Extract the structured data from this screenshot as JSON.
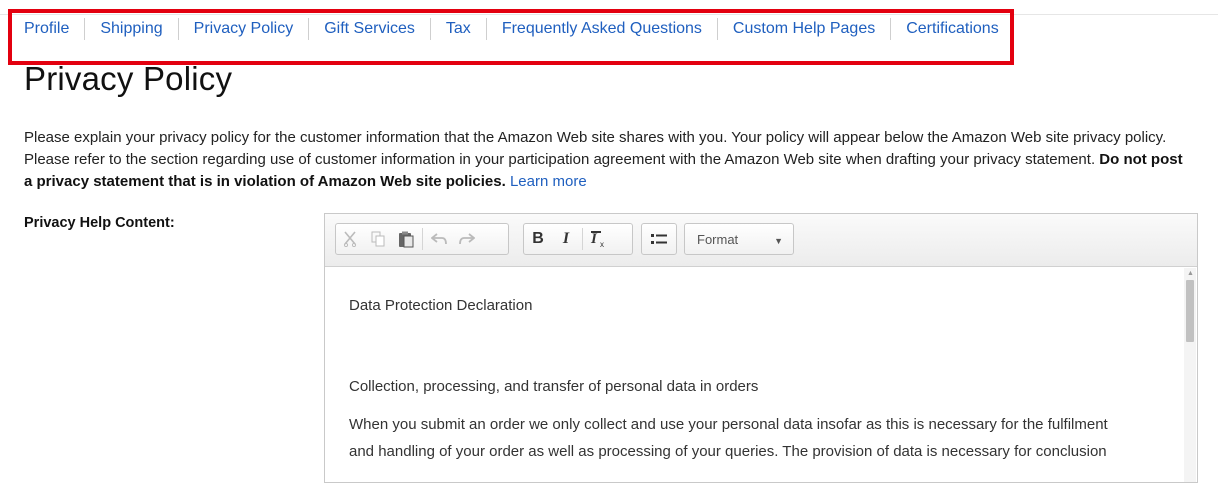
{
  "nav": {
    "tabs": [
      {
        "label": "Profile"
      },
      {
        "label": "Shipping"
      },
      {
        "label": "Privacy Policy"
      },
      {
        "label": "Gift Services"
      },
      {
        "label": "Tax"
      },
      {
        "label": "Frequently Asked Questions"
      },
      {
        "label": "Custom Help Pages"
      },
      {
        "label": "Certifications"
      }
    ],
    "highlight_color": "#e3000f",
    "link_color": "#1f5fbf"
  },
  "page": {
    "title": "Privacy Policy",
    "description": "Please explain your privacy policy for the customer information that the Amazon Web site shares with you. Your policy will appear below the Amazon Web site privacy policy. Please refer to the section regarding use of customer information in your participation agreement with the Amazon Web site when drafting your privacy statement.",
    "warning": "Do not post a privacy statement that is in violation of Amazon Web site policies.",
    "learn_more": "Learn more"
  },
  "form": {
    "field_label": "Privacy Help Content:"
  },
  "editor": {
    "toolbar": {
      "icons": [
        "cut-icon",
        "copy-icon",
        "paste-icon",
        "undo-icon",
        "redo-icon",
        "bold-icon",
        "italic-icon",
        "remove-format-icon",
        "bulleted-list-icon"
      ],
      "bold_label": "B",
      "italic_label": "I",
      "format_label": "Format"
    },
    "content": {
      "line1": "Data Protection Declaration",
      "line2": "Collection, processing, and transfer of personal data in orders",
      "line3": "When you submit an order we only collect and use your personal data insofar as this is necessary for the fulfilment",
      "line4": "and handling of your order as well as processing of your queries. The provision of data is necessary for conclusion"
    }
  }
}
